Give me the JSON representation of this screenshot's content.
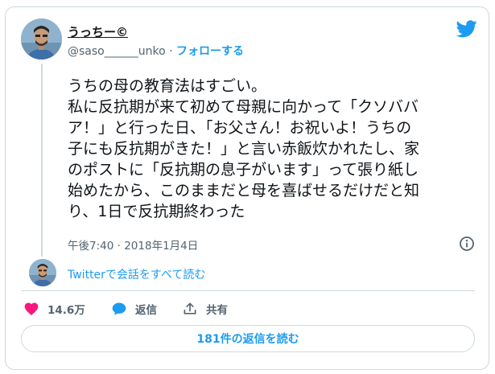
{
  "author": {
    "display_name": "うっちー©",
    "handle": "@saso______unko",
    "separator": "·",
    "follow_label": "フォローする"
  },
  "tweet": {
    "lines": [
      "うちの母の教育法はすごい。",
      "私に反抗期が来て初めて母親に向かって「クソババ",
      "ア！」と行った日、「お父さん！お祝いよ！うちの",
      "子にも反抗期がきた！」と言い赤飯炊かれたし、家",
      "のポストに「反抗期の息子がいます」って張り紙し",
      "始めたから、このままだと母を喜ばせるだけだと知",
      "り、1日で反抗期終わった"
    ],
    "time": "午後7:40",
    "date_separator": "·",
    "date": "2018年1月4日"
  },
  "conversation_link": "Twitterで会話をすべて読む",
  "actions": {
    "like_count": "14.6万",
    "reply_label": "返信",
    "share_label": "共有"
  },
  "replies_button": "181件の返信を読む",
  "icons": {
    "brand": "twitter-bird-icon",
    "info": "info-icon",
    "like": "heart-icon",
    "reply": "speech-bubble-icon",
    "share": "share-icon"
  },
  "colors": {
    "accent": "#1d9bf0",
    "like": "#f91880",
    "text": "#0f1419",
    "secondary": "#536471",
    "border": "#cfd9de"
  }
}
